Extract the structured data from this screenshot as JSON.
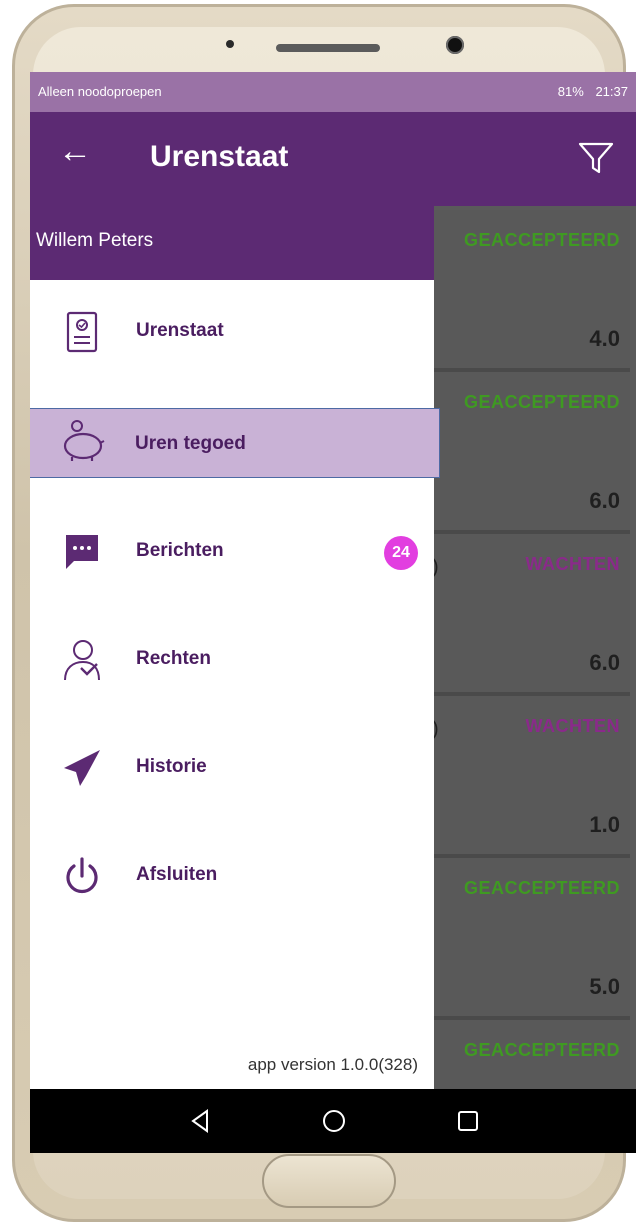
{
  "status_bar": {
    "left_text": "Alleen noodoproepen",
    "right_text": "81%",
    "time": "21:37"
  },
  "appbar": {
    "title": "Urenstaat",
    "back_icon": "arrow-left-icon",
    "filter_icon": "filter-icon"
  },
  "drawer": {
    "user_name": "Willem Peters",
    "items": [
      {
        "label": "Urenstaat",
        "icon": "document-icon"
      },
      {
        "label": "Uren tegoed",
        "icon": "piggy-bank-icon",
        "selected": true
      },
      {
        "label": "Berichten",
        "icon": "message-icon",
        "badge": "24"
      },
      {
        "label": "Rechten",
        "icon": "user-shield-icon"
      },
      {
        "label": "Historie",
        "icon": "paper-plane-icon"
      },
      {
        "label": "Afsluiten",
        "icon": "power-icon"
      }
    ],
    "version": "app version 1.0.0(328)"
  },
  "entries": [
    {
      "status": "GEACCEPTEERD",
      "hours": "4.0",
      "status_color": "#3f9a22"
    },
    {
      "status": "GEACCEPTEERD",
      "hours": "6.0",
      "status_color": "#3f9a22"
    },
    {
      "status": "WACHTEN",
      "hours": "6.0",
      "status_color": "#8a2a8a",
      "prefix": ")"
    },
    {
      "status": "WACHTEN",
      "hours": "1.0",
      "status_color": "#8a2a8a",
      "prefix": ")"
    },
    {
      "status": "GEACCEPTEERD",
      "hours": "5.0",
      "status_color": "#3f9a22"
    },
    {
      "status": "GEACCEPTEERD",
      "hours": "",
      "status_color": "#3f9a22"
    }
  ],
  "colors": {
    "primary": "#5c2a73",
    "status_bar": "#9a72a6",
    "selected_item": "#c9b2d6",
    "badge": "#e23ee0",
    "accepted": "#3f9a22",
    "waiting": "#8a2a8a"
  },
  "navbar": {
    "back_icon": "nav-back-icon",
    "home_icon": "nav-home-icon",
    "recents_icon": "nav-recents-icon"
  }
}
